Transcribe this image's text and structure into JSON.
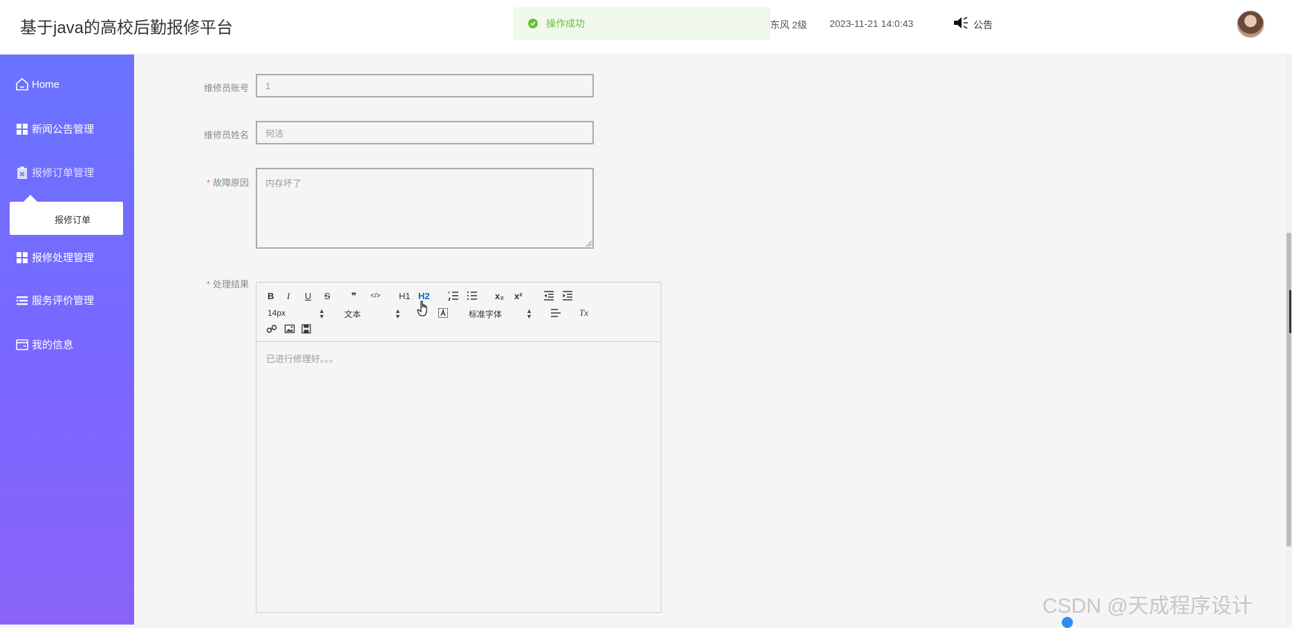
{
  "header": {
    "app_title": "基于java的高校后勤报修平台",
    "toast_message": "操作成功",
    "user_level": "东风  2级",
    "datetime": "2023-11-21 14:0:43",
    "notice_label": "公告"
  },
  "sidebar": {
    "items": [
      {
        "label": "Home",
        "icon": "home-icon"
      },
      {
        "label": "新闻公告管理",
        "icon": "grid-icon"
      },
      {
        "label": "报修订单管理",
        "icon": "clipboard-icon"
      },
      {
        "label": "报修处理管理",
        "icon": "grid-icon"
      },
      {
        "label": "服务评价管理",
        "icon": "list-icon"
      },
      {
        "label": "我的信息",
        "icon": "card-icon"
      }
    ],
    "submenu": {
      "label": "报修订单"
    }
  },
  "form": {
    "repairer_account": {
      "label": "维修员账号",
      "value": "1"
    },
    "repairer_name": {
      "label": "维修员姓名",
      "value": "何洁"
    },
    "fault_reason": {
      "label": "故障原因",
      "required_mark": "*",
      "value": "内存坏了"
    },
    "result": {
      "label": "处理结果",
      "required_mark": "*",
      "value": "已进行修理好。。。"
    }
  },
  "editor": {
    "toolbar": {
      "bold": "B",
      "italic": "I",
      "underline": "U",
      "strike": "S",
      "quote": "❞",
      "code": "</>",
      "h1": "H1",
      "h2": "H2",
      "sub": "x₂",
      "sup": "x²",
      "font_size": "14px",
      "text_style": "文本",
      "font_family": "标准字体",
      "clear_format": "Tx"
    }
  },
  "watermark": "CSDN @天成程序设计",
  "colors": {
    "sidebar_top": "#6a73ff",
    "sidebar_bottom": "#8a63f7",
    "toast_green": "#67c23a",
    "required_red": "#f56c6c",
    "active_blue": "#0066cc"
  }
}
